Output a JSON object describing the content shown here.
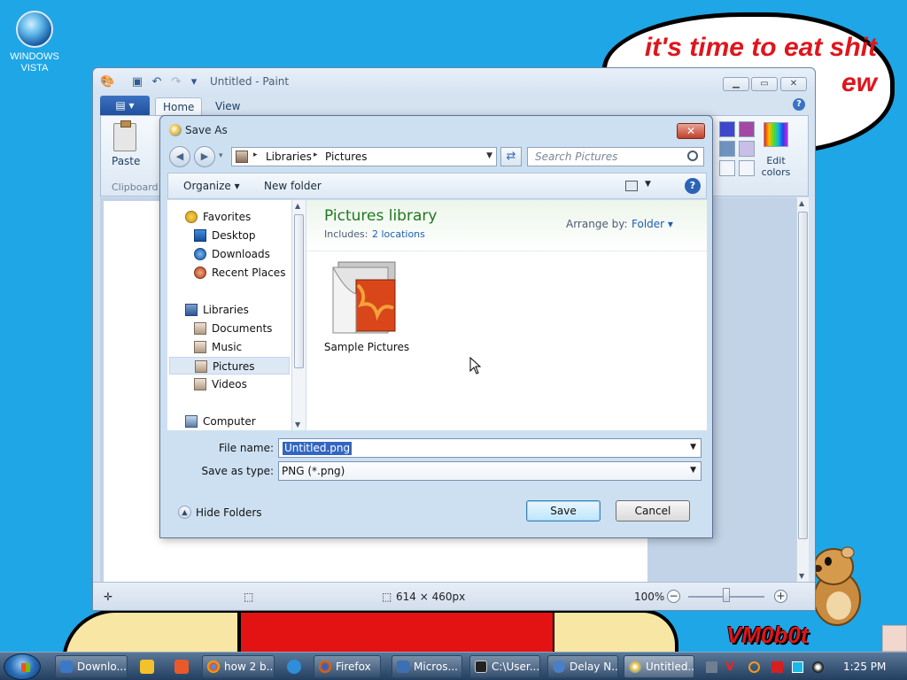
{
  "desktop": {
    "icon_label": "WINDOWS VISTA",
    "bubble_line1": "it's time to eat shit",
    "bubble_line2": "ew",
    "watermark": "VM0b0t"
  },
  "paint": {
    "title": "Untitled - Paint",
    "tabs": [
      "Home",
      "View"
    ],
    "paste_label": "Paste",
    "clipboard_label": "Clipboard",
    "edit_colors_label": "Edit colors",
    "status_size": "614 × 460px",
    "zoom": "100%"
  },
  "dialog": {
    "title": "Save As",
    "breadcrumb": [
      "Libraries",
      "Pictures"
    ],
    "search_placeholder": "Search Pictures",
    "toolbar": {
      "organize": "Organize",
      "new_folder": "New folder"
    },
    "nav": {
      "favorites": "Favorites",
      "favorites_items": [
        "Desktop",
        "Downloads",
        "Recent Places"
      ],
      "libraries": "Libraries",
      "libraries_items": [
        "Documents",
        "Music",
        "Pictures",
        "Videos"
      ],
      "computer": "Computer"
    },
    "library_title": "Pictures library",
    "includes_label": "Includes:",
    "locations": "2 locations",
    "arrange_label": "Arrange by:",
    "arrange_value": "Folder",
    "folder_name": "Sample Pictures",
    "file_name_label": "File name:",
    "file_name_value": "Untitled.png",
    "save_type_label": "Save as type:",
    "save_type_value": "PNG (*.png)",
    "hide_folders": "Hide Folders",
    "save_button": "Save",
    "cancel_button": "Cancel"
  },
  "taskbar": {
    "buttons": [
      "Downlo...",
      "how 2 b...",
      "Firefox",
      "Micros...",
      "C:\\User...",
      "Delay N...",
      "Untitled..."
    ],
    "clock": "1:25 PM"
  }
}
